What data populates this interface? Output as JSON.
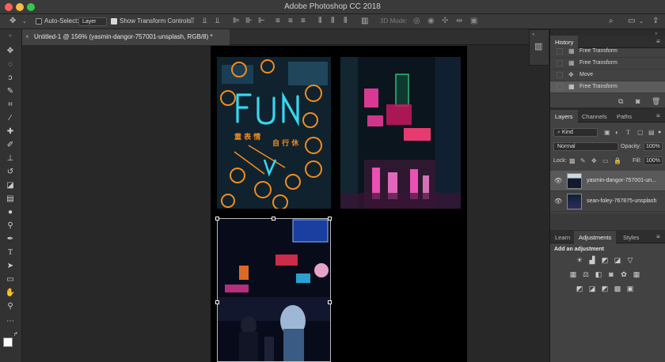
{
  "app": {
    "title": "Adobe Photoshop CC 2018"
  },
  "options_bar": {
    "auto_select_label": "Auto-Select:",
    "auto_select_checked": false,
    "layer_dropdown": "Layer",
    "show_transform_label": "Show Transform Controls",
    "show_transform_checked": true,
    "mode_3d_label": "3D Mode:"
  },
  "document": {
    "tab_label": "Untitled-1 @ 156% (yasmin-dangor-757001-unsplash, RGB/8) *"
  },
  "history": {
    "tab": "History",
    "items": [
      {
        "label": "Free Transform",
        "selected": false
      },
      {
        "label": "Free Transform",
        "selected": false
      },
      {
        "label": "Move",
        "selected": false
      },
      {
        "label": "Free Transform",
        "selected": true
      }
    ]
  },
  "layers": {
    "tabs": [
      "Layers",
      "Channels",
      "Paths"
    ],
    "active_tab": "Layers",
    "filter": "Kind",
    "blend_mode": "Normal",
    "opacity_label": "Opacity:",
    "opacity_value": "100%",
    "lock_label": "Lock:",
    "fill_label": "Fill:",
    "fill_value": "100%",
    "items": [
      {
        "name": "yasmin-dangor-757001-un...",
        "visible": true,
        "selected": true
      },
      {
        "name": "sean-foley-767875-unsplash",
        "visible": true,
        "selected": false
      }
    ]
  },
  "adjustments": {
    "tabs": [
      "Learn",
      "Adjustments",
      "Styles"
    ],
    "active_tab": "Adjustments",
    "heading": "Add an adjustment"
  },
  "colors": {
    "neon_orange": "#f28b1e",
    "neon_cyan": "#38d6f0",
    "neon_pink": "#ff3fa8",
    "panel_bg": "#424242",
    "app_bg": "#282828"
  }
}
